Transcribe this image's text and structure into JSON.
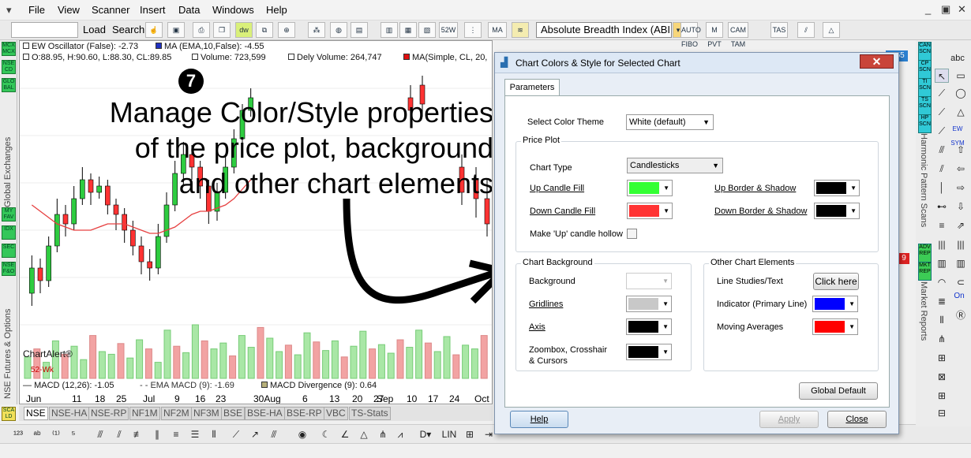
{
  "menubar": {
    "items": [
      "File",
      "View",
      "Scanner",
      "Insert",
      "Data",
      "Windows",
      "Help"
    ],
    "window_controls": [
      "_",
      "▣",
      "✕"
    ]
  },
  "toolbar": {
    "load_label": "Load",
    "search_label": "Search",
    "indicator_selected": "Absolute Breadth Index (ABI",
    "btn_52wk": "52W Hi/Lo",
    "btn_ma": "MA",
    "btn_auto_fibo": "AUTO FIBO",
    "btn_m_pvt": "M PVT",
    "btn_cam_tam": "CAM TAM",
    "btn_tas": "TAS",
    "right_badge": "1.55"
  },
  "left_rail": {
    "buttons": [
      "MCX MCX",
      "NSE CD",
      "GLO BAL",
      "MY FAV",
      "IDX",
      "SEC",
      "NSE F&O",
      "SCA LD"
    ],
    "labels": [
      "Global Exchanges",
      "NSE Futures & Options"
    ]
  },
  "chart": {
    "legend_line1": {
      "ew": "EW Oscillator (False): -2.73",
      "ma": "MA (EMA,10,False): -4.55"
    },
    "legend_line2": {
      "ohlc": "O:88.95, H:90.60, L:88.30, CL:89.85",
      "volume": "Volume: 723,599",
      "dely": "Dely Volume: 264,747",
      "ma_simple": "MA(Simple, CL, 20,"
    },
    "annotation_number": "7",
    "annotation_lines": [
      "Manage Color/Style properties",
      "of the price plot, background",
      "and other chart elements"
    ],
    "watermark": "ChartAlert®",
    "hi_label": "52-Wk",
    "macd_legend": {
      "macd": "MACD (12,26): -1.05",
      "ema": "EMA MACD (9): -1.69",
      "div": "MACD Divergence (9): 0.64"
    },
    "x_labels": [
      "Jun",
      "11",
      "18",
      "25",
      "Jul",
      "9",
      "16",
      "23",
      "30Aug",
      "6",
      "13",
      "20",
      "27",
      "Sep",
      "10",
      "17",
      "24",
      "Oct"
    ],
    "colors": {
      "up": "#2ecc40",
      "down": "#ff3333",
      "ma_line": "#e64040",
      "vol_up": "#a9e7a6",
      "vol_down": "#f2a3a3"
    }
  },
  "chart_data": {
    "type": "candlestick",
    "candles": [
      {
        "o": 30,
        "c": 38,
        "h": 42,
        "l": 26
      },
      {
        "o": 38,
        "c": 34,
        "h": 41,
        "l": 30
      },
      {
        "o": 34,
        "c": 45,
        "h": 48,
        "l": 32
      },
      {
        "o": 45,
        "c": 55,
        "h": 60,
        "l": 43
      },
      {
        "o": 55,
        "c": 52,
        "h": 58,
        "l": 48
      },
      {
        "o": 52,
        "c": 60,
        "h": 64,
        "l": 50
      },
      {
        "o": 60,
        "c": 66,
        "h": 70,
        "l": 58
      },
      {
        "o": 66,
        "c": 62,
        "h": 68,
        "l": 58
      },
      {
        "o": 62,
        "c": 64,
        "h": 67,
        "l": 60
      },
      {
        "o": 64,
        "c": 58,
        "h": 66,
        "l": 55
      },
      {
        "o": 58,
        "c": 55,
        "h": 60,
        "l": 50
      },
      {
        "o": 55,
        "c": 50,
        "h": 57,
        "l": 46
      },
      {
        "o": 50,
        "c": 45,
        "h": 53,
        "l": 42
      },
      {
        "o": 45,
        "c": 40,
        "h": 48,
        "l": 36
      },
      {
        "o": 40,
        "c": 38,
        "h": 44,
        "l": 34
      },
      {
        "o": 38,
        "c": 48,
        "h": 52,
        "l": 36
      },
      {
        "o": 48,
        "c": 58,
        "h": 62,
        "l": 46
      },
      {
        "o": 58,
        "c": 68,
        "h": 72,
        "l": 56
      },
      {
        "o": 68,
        "c": 74,
        "h": 78,
        "l": 64
      },
      {
        "o": 74,
        "c": 70,
        "h": 77,
        "l": 66
      },
      {
        "o": 70,
        "c": 64,
        "h": 72,
        "l": 60
      },
      {
        "o": 64,
        "c": 56,
        "h": 66,
        "l": 52
      },
      {
        "o": 56,
        "c": 62,
        "h": 65,
        "l": 53
      },
      {
        "o": 62,
        "c": 70,
        "h": 74,
        "l": 60
      },
      {
        "o": 70,
        "c": 79,
        "h": 82,
        "l": 68
      },
      {
        "o": 79,
        "c": 88,
        "h": 90,
        "l": 76
      },
      {
        "o": 88,
        "c": 92,
        "h": 95,
        "l": 86
      }
    ],
    "ma": [
      58,
      56,
      54,
      52,
      51,
      50,
      50,
      50,
      51,
      52,
      52,
      52,
      51,
      50,
      49,
      49,
      50,
      51,
      53,
      55,
      56,
      56,
      57,
      58,
      60,
      63,
      66
    ],
    "volume": [
      40,
      55,
      30,
      70,
      45,
      60,
      35,
      80,
      50,
      45,
      65,
      38,
      72,
      55,
      30,
      90,
      60,
      48,
      100,
      70,
      55,
      66,
      42,
      80,
      58,
      95,
      75,
      50,
      62,
      44,
      85,
      68,
      52,
      70,
      40,
      60,
      88,
      55,
      63,
      47,
      72,
      58,
      90,
      66,
      50,
      78,
      44,
      62,
      55,
      80
    ]
  },
  "exchange_tabs": [
    "NSE",
    "NSE-HA",
    "NSE-RP",
    "NF1M",
    "NF2M",
    "NF3M",
    "BSE",
    "BSE-HA",
    "BSE-RP",
    "VBC",
    "TS-Stats"
  ],
  "right_panel": {
    "scan_buttons": [
      "CAN SCN",
      "CP SCN",
      "TI SCN",
      "TS SCN",
      "HP SCN"
    ],
    "scan_label": "Harmonic Pattern Scans",
    "report_buttons": [
      "ADV REP",
      "MKT REP"
    ],
    "report_label": "Market Reports",
    "red_badge": "9",
    "abc_label": "abc",
    "on_label": "On",
    "ew_label": "EW SYM"
  },
  "dialog": {
    "title": "Chart Colors & Style for Selected Chart",
    "close_x": "✕",
    "tab": "Parameters",
    "theme_label": "Select Color Theme",
    "theme_value": "White (default)",
    "price_plot": {
      "group": "Price Plot",
      "chart_type_label": "Chart Type",
      "chart_type_value": "Candlesticks",
      "up_fill_label": "Up Candle Fill",
      "down_fill_label": "Down Candle Fill",
      "up_border_label": "Up Border & Shadow",
      "down_border_label": "Down Border & Shadow",
      "hollow_label": "Make 'Up' candle hollow",
      "up_fill_color": "#33ff33",
      "down_fill_color": "#ff3333",
      "up_border_color": "#000000",
      "down_border_color": "#000000"
    },
    "background": {
      "group": "Chart Background",
      "background_label": "Background",
      "gridlines_label": "Gridlines",
      "axis_label": "Axis",
      "zoom_label_1": "Zoombox, Crosshair",
      "zoom_label_2": "& Cursors",
      "background_color": "#ffffff",
      "gridlines_color": "#c8c8c8",
      "axis_color": "#000000",
      "zoom_color": "#000000"
    },
    "other": {
      "group": "Other Chart Elements",
      "line_label": "Line Studies/Text",
      "line_button": "Click here",
      "indicator_label": "Indicator (Primary Line)",
      "ma_label": "Moving Averages",
      "indicator_color": "#0000ff",
      "ma_color": "#ff0000"
    },
    "global_default": "Global Default",
    "help": "Help",
    "apply": "Apply",
    "close": "Close"
  }
}
